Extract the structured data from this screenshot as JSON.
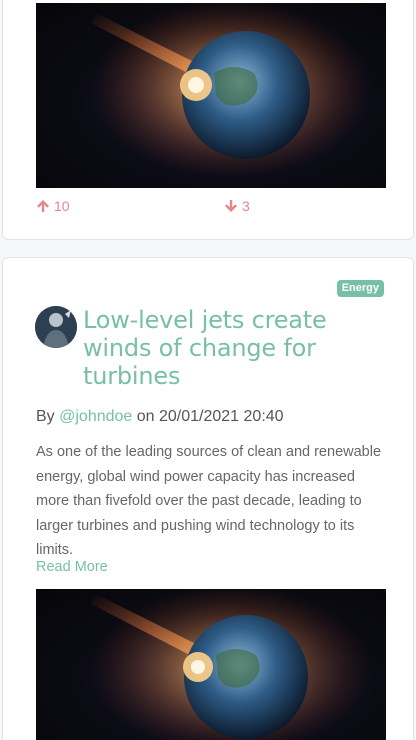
{
  "posts": [
    {
      "image_alt": "Asteroid striking the Earth",
      "upvotes": "10",
      "downvotes": "3"
    },
    {
      "category": "Energy",
      "title": "Low-level jets create winds of change for turbines",
      "byline_prefix": "By ",
      "author": "@johndoe",
      "byline_mid": " on ",
      "date": "20/01/2021 20:40",
      "excerpt": "As one of the leading sources of clean and renewable energy, global wind power capacity has increased more than fivefold over the past decade, leading to larger turbines and pushing wind technology to its limits.",
      "read_more": "Read More",
      "image_alt": "Asteroid striking the Earth"
    }
  ],
  "icons": {
    "upvote": "arrow-up-icon",
    "downvote": "arrow-down-icon"
  },
  "colors": {
    "accent": "#78bfa8",
    "vote": "#e4878a"
  }
}
